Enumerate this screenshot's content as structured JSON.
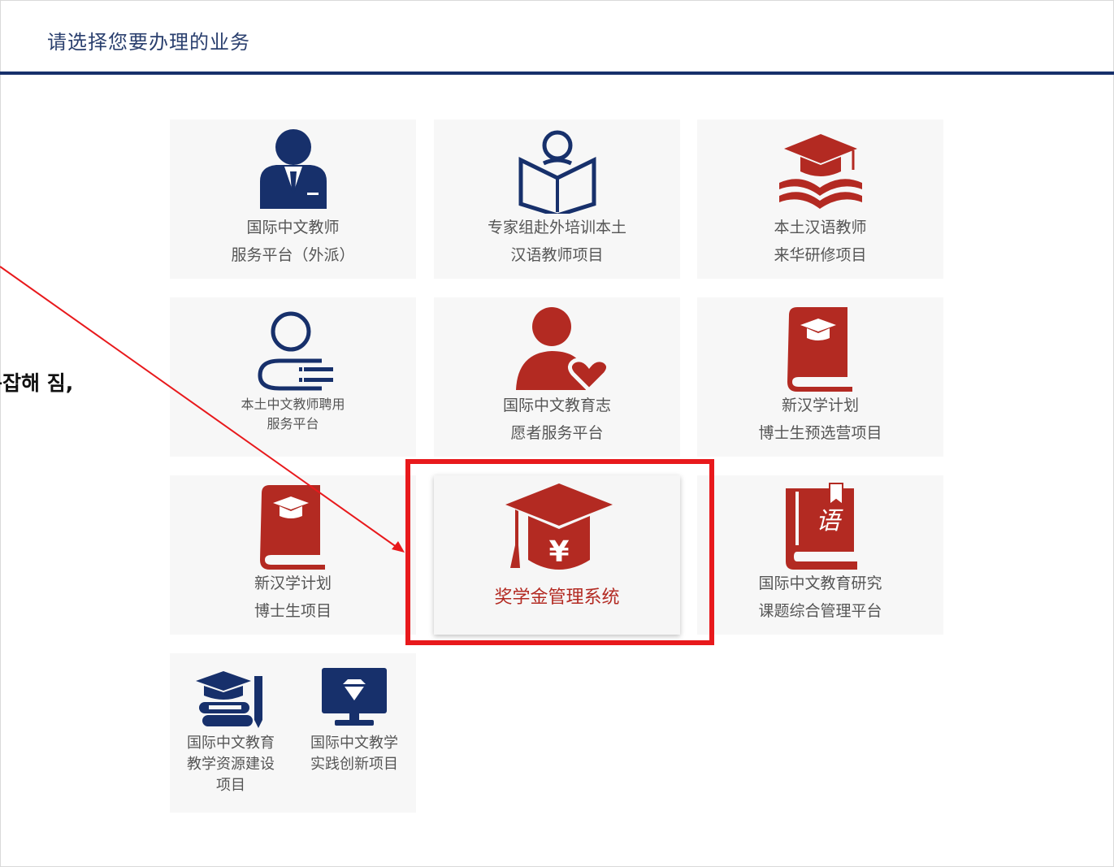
{
  "header": {
    "title": "请选择您要办理的业务"
  },
  "tiles": [
    {
      "line1": "国际中文教师",
      "line2": "服务平台（外派）"
    },
    {
      "line1": "专家组赴外培训本土",
      "line2": "汉语教师项目"
    },
    {
      "line1": "本土汉语教师",
      "line2": "来华研修项目"
    },
    {
      "line1": "本土中文教师聘用",
      "line2": "服务平台"
    },
    {
      "line1": "国际中文教育志",
      "line2": "愿者服务平台"
    },
    {
      "line1": "新汉学计划",
      "line2": "博士生预选营项目"
    },
    {
      "line1": "新汉学计划",
      "line2": "博士生项目"
    },
    {
      "line1": "奖学金管理系统"
    },
    {
      "line1": "国际中文教育研究",
      "line2": "课题综合管理平台"
    }
  ],
  "combined_tile": {
    "left": {
      "line1": "国际中文教育",
      "line2": "教学资源建设",
      "line3": "项目"
    },
    "right": {
      "line1": "国际中文教学",
      "line2": "实践创新项目"
    }
  },
  "annotation": {
    "text": "복잡해 짐,"
  },
  "colors": {
    "navy": "#17306b",
    "red": "#b32a22",
    "highlight": "#e8191c",
    "tile_bg": "#f7f7f7"
  }
}
